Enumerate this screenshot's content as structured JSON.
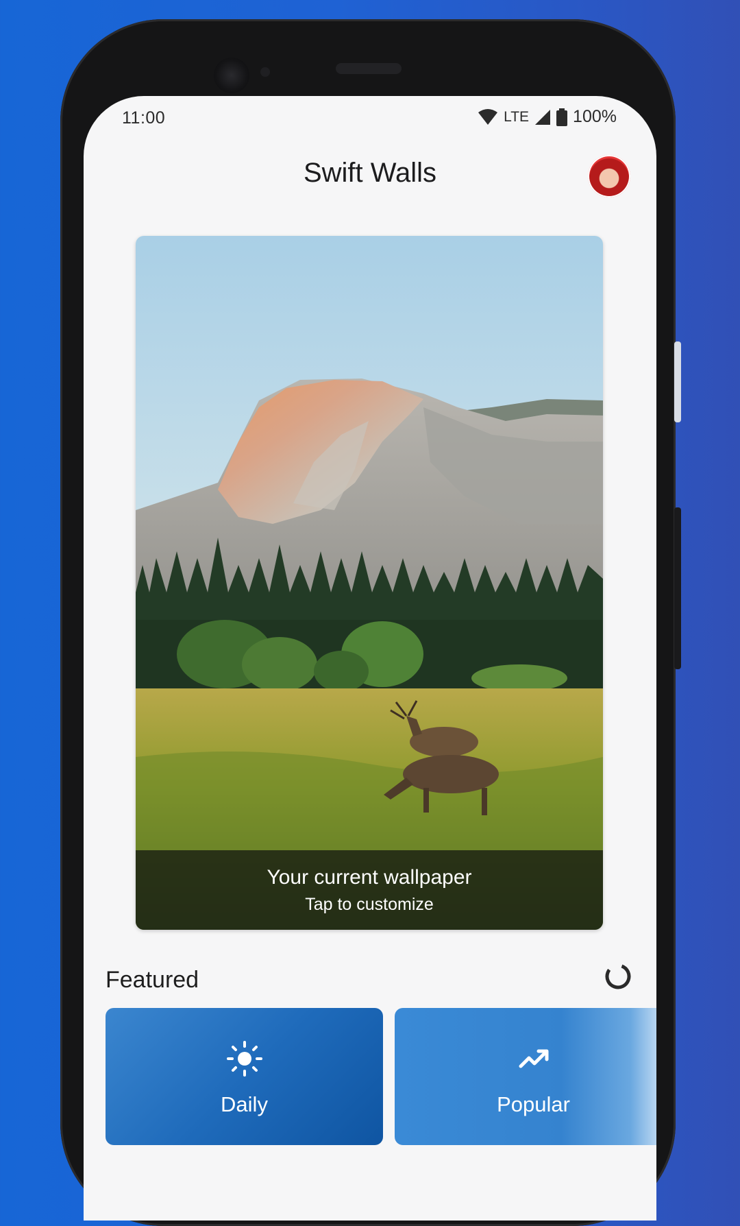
{
  "status_bar": {
    "time": "11:00",
    "network": "LTE",
    "battery": "100%"
  },
  "app": {
    "title": "Swift Walls"
  },
  "wallpaper": {
    "caption_title": "Your current wallpaper",
    "caption_subtitle": "Tap to customize"
  },
  "featured": {
    "label": "Featured",
    "cards": [
      {
        "label": "Daily",
        "icon": "sun-icon"
      },
      {
        "label": "Popular",
        "icon": "trending-up-icon"
      }
    ]
  },
  "colors": {
    "background_blue": "#1f62d4",
    "card_blue": "#1f6bbb"
  }
}
